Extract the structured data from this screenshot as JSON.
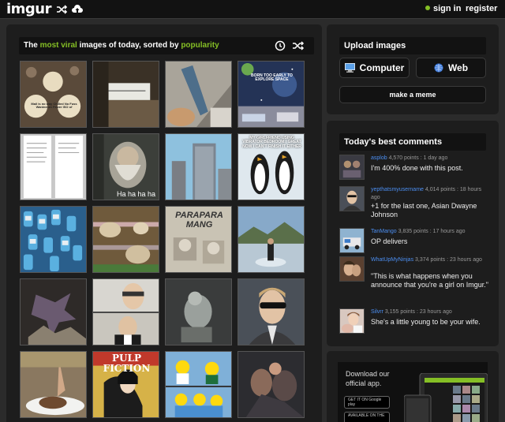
{
  "header": {
    "logo": "imgur",
    "signin": "sign in",
    "register": "register"
  },
  "viral": {
    "prefix": "The ",
    "most_viral": "most viral",
    "middle": " images of today, sorted by ",
    "sort": "popularity"
  },
  "thumbs": [
    {
      "caption": "Mail is no way Chilled No Fuss Wanted on Fewer ISO of"
    },
    {
      "caption": ""
    },
    {
      "caption": ""
    },
    {
      "caption": "BORN TOO EARLY TO EXPLORE SPACE"
    },
    {
      "caption": ""
    },
    {
      "caption": "Ha ha ha ha"
    },
    {
      "caption": ""
    },
    {
      "caption": "MY GIRLFRIEND USING VIBRATOR BEDROOM / GREAT NOW I CAN'T FINISH IT EITHER"
    },
    {
      "caption": ""
    },
    {
      "caption": ""
    },
    {
      "caption": "PARAPARA MANG"
    },
    {
      "caption": ""
    },
    {
      "caption": ""
    },
    {
      "caption": ""
    },
    {
      "caption": ""
    },
    {
      "caption": ""
    },
    {
      "caption": ""
    },
    {
      "caption": "PULP FICTION"
    },
    {
      "caption": ""
    },
    {
      "caption": ""
    }
  ],
  "upload": {
    "title": "Upload images",
    "computer": "Computer",
    "web": "Web",
    "meme": "make a meme"
  },
  "comments": {
    "title": "Today's best comments",
    "items": [
      {
        "user": "asplob",
        "points": "4,570 points",
        "time": "1 day ago",
        "text": "I'm 400% done with this post."
      },
      {
        "user": "yepthatsmyusername",
        "points": "4,014 points",
        "time": "18 hours ago",
        "text": "+1 for the last one, Asian Dwayne Johnson"
      },
      {
        "user": "TanMango",
        "points": "3,835 points",
        "time": "17 hours ago",
        "text": "OP delivers"
      },
      {
        "user": "WhatUpMyNinjas",
        "points": "3,374 points",
        "time": "23 hours ago",
        "text": "\"This is what happens when you announce that you're a girl on Imgur.\""
      },
      {
        "user": "Silvrr",
        "points": "3,155 points",
        "time": "23 hours ago",
        "text": "She's a little young to be your wife."
      }
    ]
  },
  "app": {
    "text": "Download our official app.",
    "google": "GET IT ON Google play",
    "store": "AVAILABLE ON THE"
  },
  "colors": {
    "accent": "#85bf25",
    "link": "#4c8ff2",
    "panel": "#1d1d1d",
    "background": "#2b2b2b"
  }
}
